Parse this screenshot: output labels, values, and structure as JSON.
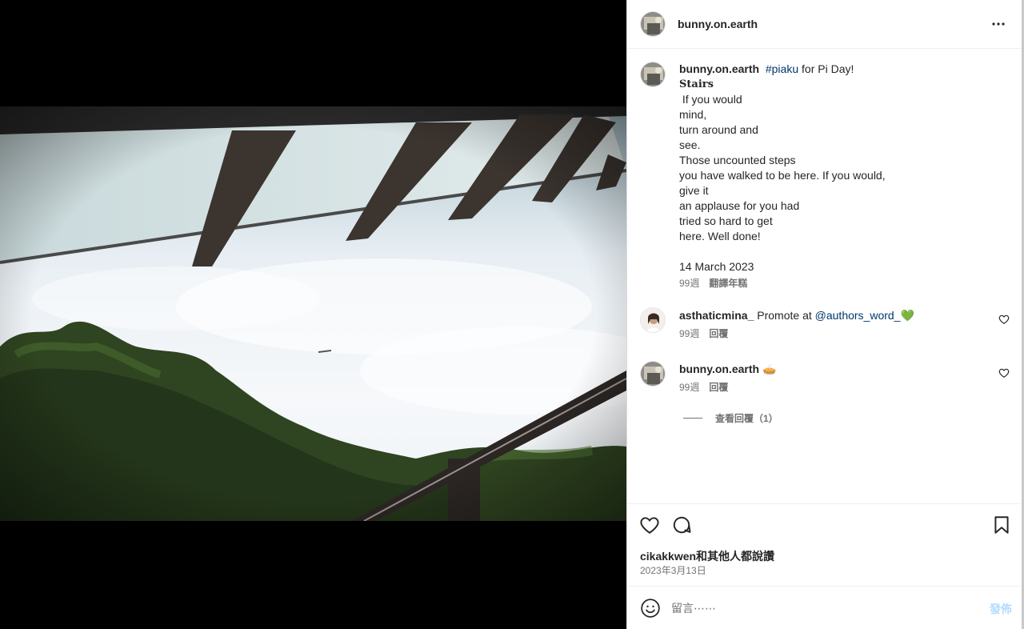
{
  "post": {
    "username": "bunny.on.earth",
    "more_icon": "more-horizontal-icon",
    "caption": {
      "username": "bunny.on.earth",
      "hashtag": "#piaku",
      "intro": " for Pi Day!",
      "title": "Stairs",
      "lines": [
        " If you would",
        "mind,",
        "turn around and",
        "see.",
        "Those uncounted steps",
        "you have walked to be here. If you would,",
        "give it",
        "an applause for you had",
        "tried so hard to get",
        "here. Well done!",
        "",
        "14 March 2023"
      ],
      "age": "99週",
      "translate_label": "翻譯年糕"
    },
    "comments": [
      {
        "username": "asthaticmina_",
        "text": " Promote at ",
        "mention": "@authors_word_",
        "emoji": "💚",
        "age": "99週",
        "reply_label": "回覆"
      },
      {
        "username": "bunny.on.earth",
        "text": " ",
        "emoji": "🥧",
        "age": "99週",
        "reply_label": "回覆",
        "view_replies_label": "查看回覆（1）"
      }
    ],
    "likes_text": "cikakkwen和其他人都說讚",
    "date": "2023年3月13日",
    "composer": {
      "placeholder": "留言⋯⋯",
      "post_label": "發佈"
    }
  },
  "colors": {
    "link": "#00376b",
    "muted": "#737373",
    "post_button_disabled": "#b3dbff",
    "border": "#efefef"
  }
}
